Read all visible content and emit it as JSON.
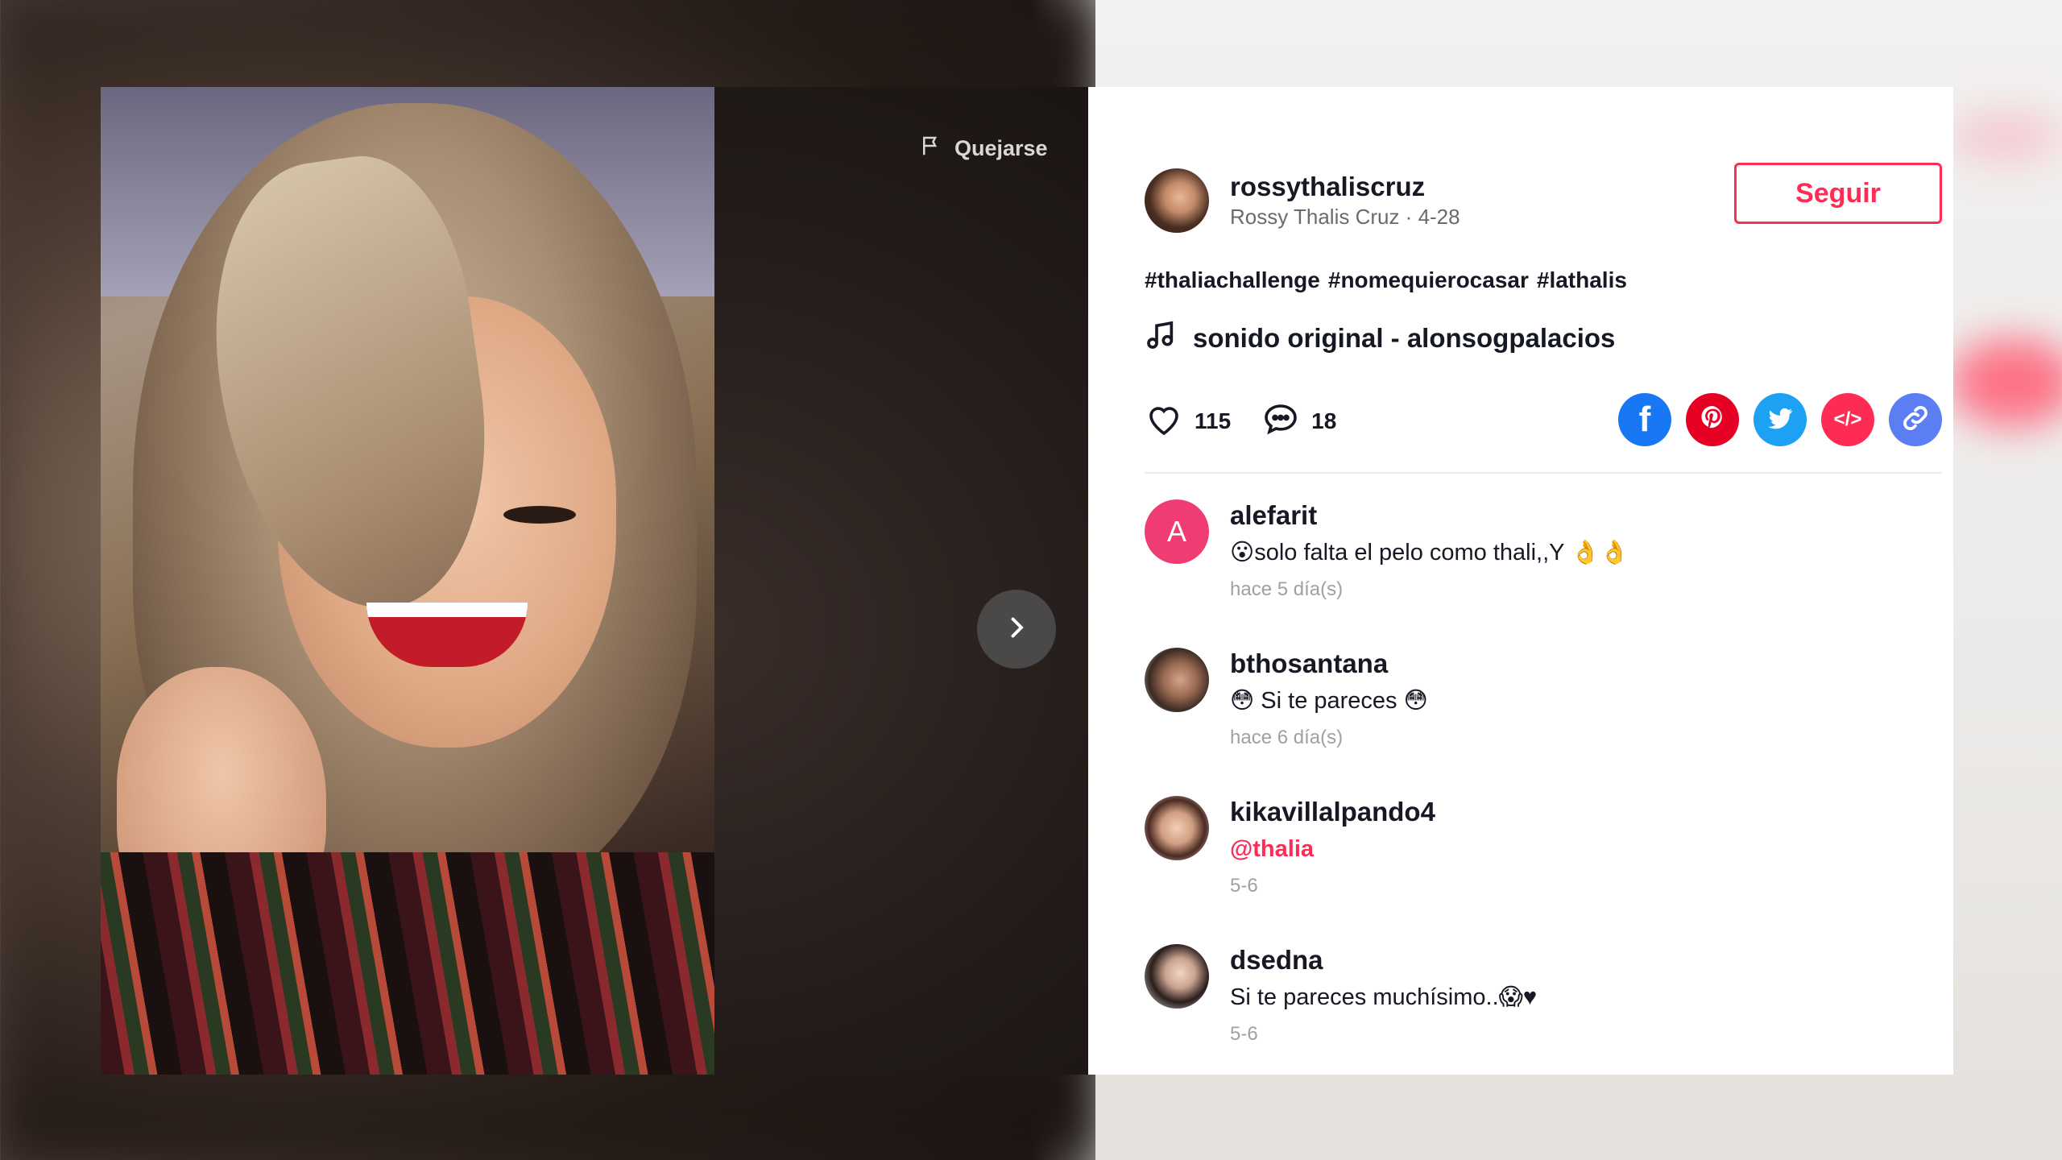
{
  "video": {
    "report_label": "Quejarse"
  },
  "author": {
    "username": "rossythaliscruz",
    "subline": "Rossy Thalis Cruz · 4-28",
    "follow_label": "Seguir"
  },
  "hashtags": [
    "#thaliachallenge",
    "#nomequierocasar",
    "#lathalis"
  ],
  "music": "sonido original - alonsogpalacios",
  "stats": {
    "likes": "115",
    "comments": "18"
  },
  "share": {
    "facebook_glyph": "f",
    "embed_glyph": "</>"
  },
  "colors": {
    "accent": "#fe2c55",
    "facebook": "#1877f2",
    "pinterest": "#e60023",
    "twitter": "#1da1f2",
    "embed": "#fe2c55",
    "link": "#5b7ff2"
  },
  "comments": [
    {
      "avatar_letter": "A",
      "user": "alefarit",
      "text": "😮solo falta el pelo como thali,,Y 👌👌",
      "time": "hace 5 día(s)"
    },
    {
      "user": "bthosantana",
      "text": "😳 Si te pareces 😳",
      "time": "hace 6 día(s)"
    },
    {
      "user": "kikavillalpando4",
      "text": "@thalia",
      "time": "5-6"
    },
    {
      "user": "dsedna",
      "text": "Si te pareces muchísimo..😱♥",
      "time": "5-6"
    }
  ]
}
